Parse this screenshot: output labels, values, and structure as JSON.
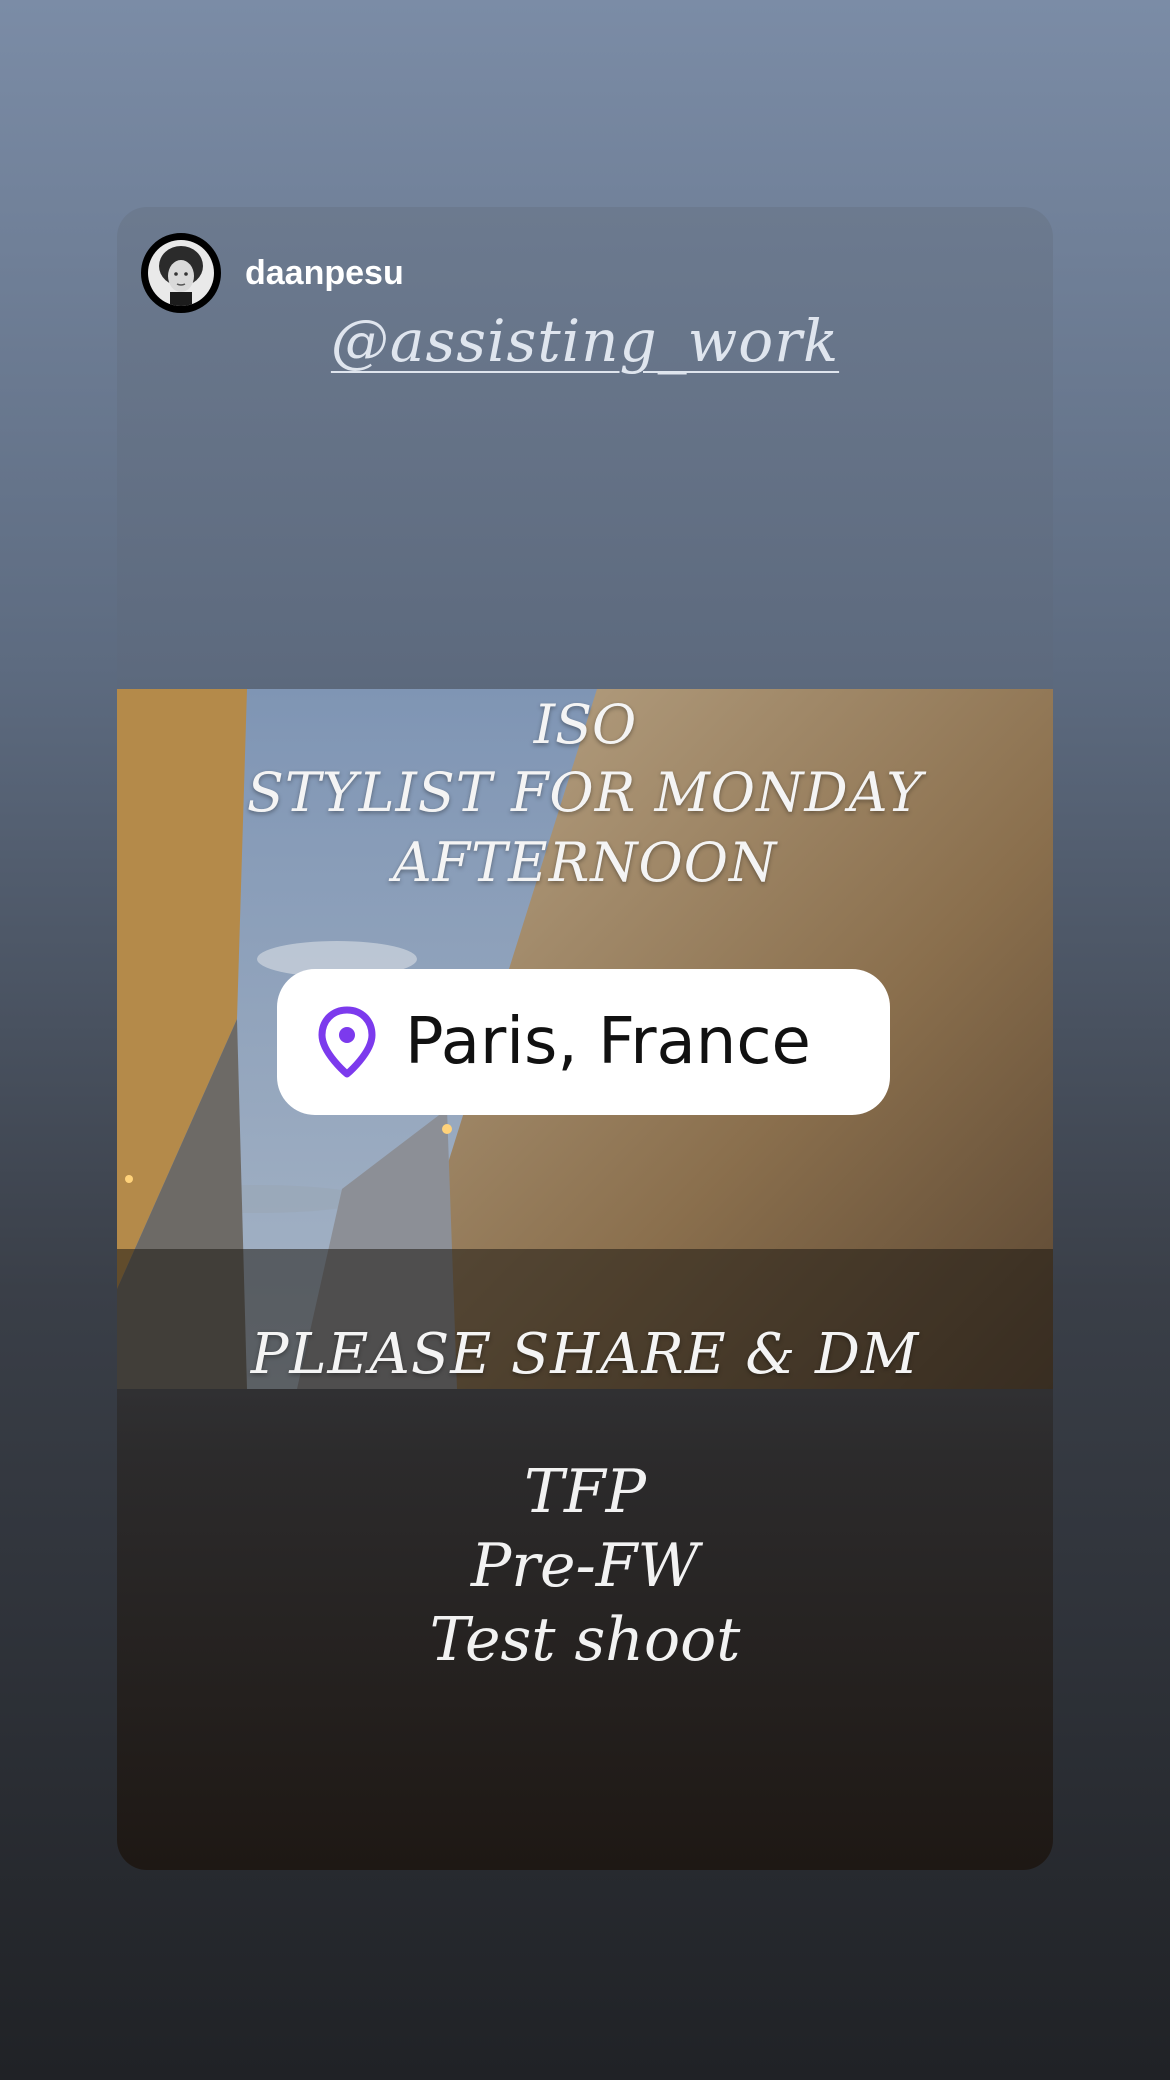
{
  "story": {
    "username": "daanpesu",
    "mention": "@assisting_work",
    "photo_text": {
      "line1": "ISO",
      "line2": "STYLIST FOR MONDAY",
      "line3": "AFTERNOON",
      "footer": "PLEASE SHARE & DM"
    },
    "location": "Paris, France",
    "bottom_lines": [
      "TFP",
      "Pre-FW",
      "Test shoot"
    ]
  },
  "colors": {
    "pin": "#7c3aed",
    "sticker_bg": "#ffffff"
  },
  "icons": {
    "location": "location-pin-icon",
    "avatar": "profile-avatar"
  }
}
